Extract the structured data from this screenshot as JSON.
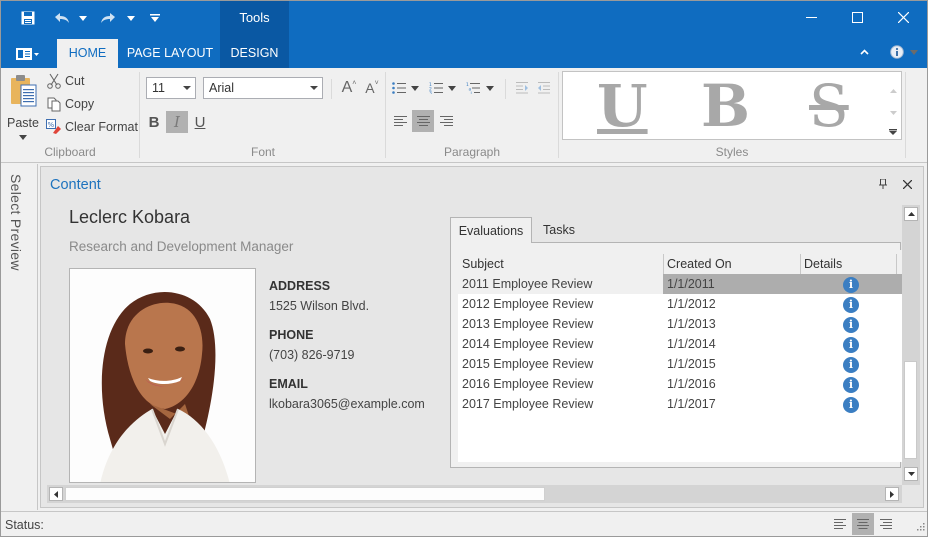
{
  "window": {
    "context_tab_group": "Tools",
    "quick_access": [
      "save-icon",
      "undo-icon",
      "undo-dropdown-icon",
      "redo-icon",
      "redo-dropdown-icon",
      "customize-qat-icon"
    ],
    "controls": [
      "minimize-icon",
      "maximize-icon",
      "close-icon"
    ]
  },
  "ribbon": {
    "app_menu_icon": "app-menu-icon",
    "tabs": [
      {
        "label": "HOME",
        "active": true
      },
      {
        "label": "PAGE LAYOUT",
        "active": false
      },
      {
        "label": "DESIGN",
        "active": false
      }
    ],
    "clipboard": {
      "paste_label": "Paste",
      "cut_label": "Cut",
      "copy_label": "Copy",
      "clear_format_label": "Clear Format",
      "group_label": "Clipboard"
    },
    "font": {
      "size_value": "11",
      "family_value": "Arial",
      "grow_label": "A",
      "shrink_label": "A",
      "bold_label": "B",
      "italic_label": "I",
      "underline_label": "U",
      "italic_pressed": true,
      "group_label": "Font"
    },
    "paragraph": {
      "group_label": "Paragraph",
      "alignment_selected": "center"
    },
    "styles": {
      "items": [
        "U",
        "B",
        "S"
      ],
      "group_label": "Styles"
    }
  },
  "side_panel": {
    "label": "Select Preview"
  },
  "content": {
    "title": "Content",
    "employee": {
      "name": "Leclerc Kobara",
      "title": "Research and Development Manager",
      "address_label": "ADDRESS",
      "address": "1525 Wilson Blvd.",
      "phone_label": "PHONE",
      "phone": "(703) 826-9719",
      "email_label": "EMAIL",
      "email": "lkobara3065@example.com"
    },
    "tabs": [
      {
        "label": "Evaluations",
        "active": true
      },
      {
        "label": "Tasks",
        "active": false
      }
    ],
    "grid": {
      "columns": [
        "Subject",
        "Created On",
        "Details"
      ],
      "rows": [
        {
          "subject": "2011 Employee Review",
          "created_on": "1/1/2011",
          "details": "i",
          "selected": true
        },
        {
          "subject": "2012 Employee Review",
          "created_on": "1/1/2012",
          "details": "i",
          "selected": false
        },
        {
          "subject": "2013 Employee Review",
          "created_on": "1/1/2013",
          "details": "i",
          "selected": false
        },
        {
          "subject": "2014 Employee Review",
          "created_on": "1/1/2014",
          "details": "i",
          "selected": false
        },
        {
          "subject": "2015 Employee Review",
          "created_on": "1/1/2015",
          "details": "i",
          "selected": false
        },
        {
          "subject": "2016 Employee Review",
          "created_on": "1/1/2016",
          "details": "i",
          "selected": false
        },
        {
          "subject": "2017 Employee Review",
          "created_on": "1/1/2017",
          "details": "i",
          "selected": false
        }
      ]
    }
  },
  "statusbar": {
    "label": "Status:",
    "alignment_selected": "center"
  },
  "colors": {
    "accent": "#0f6cc0",
    "context_tab": "#0a58a3",
    "title_link": "#1e73be",
    "info_icon": "#3b7ec2",
    "selected_cell": "#adadad"
  }
}
